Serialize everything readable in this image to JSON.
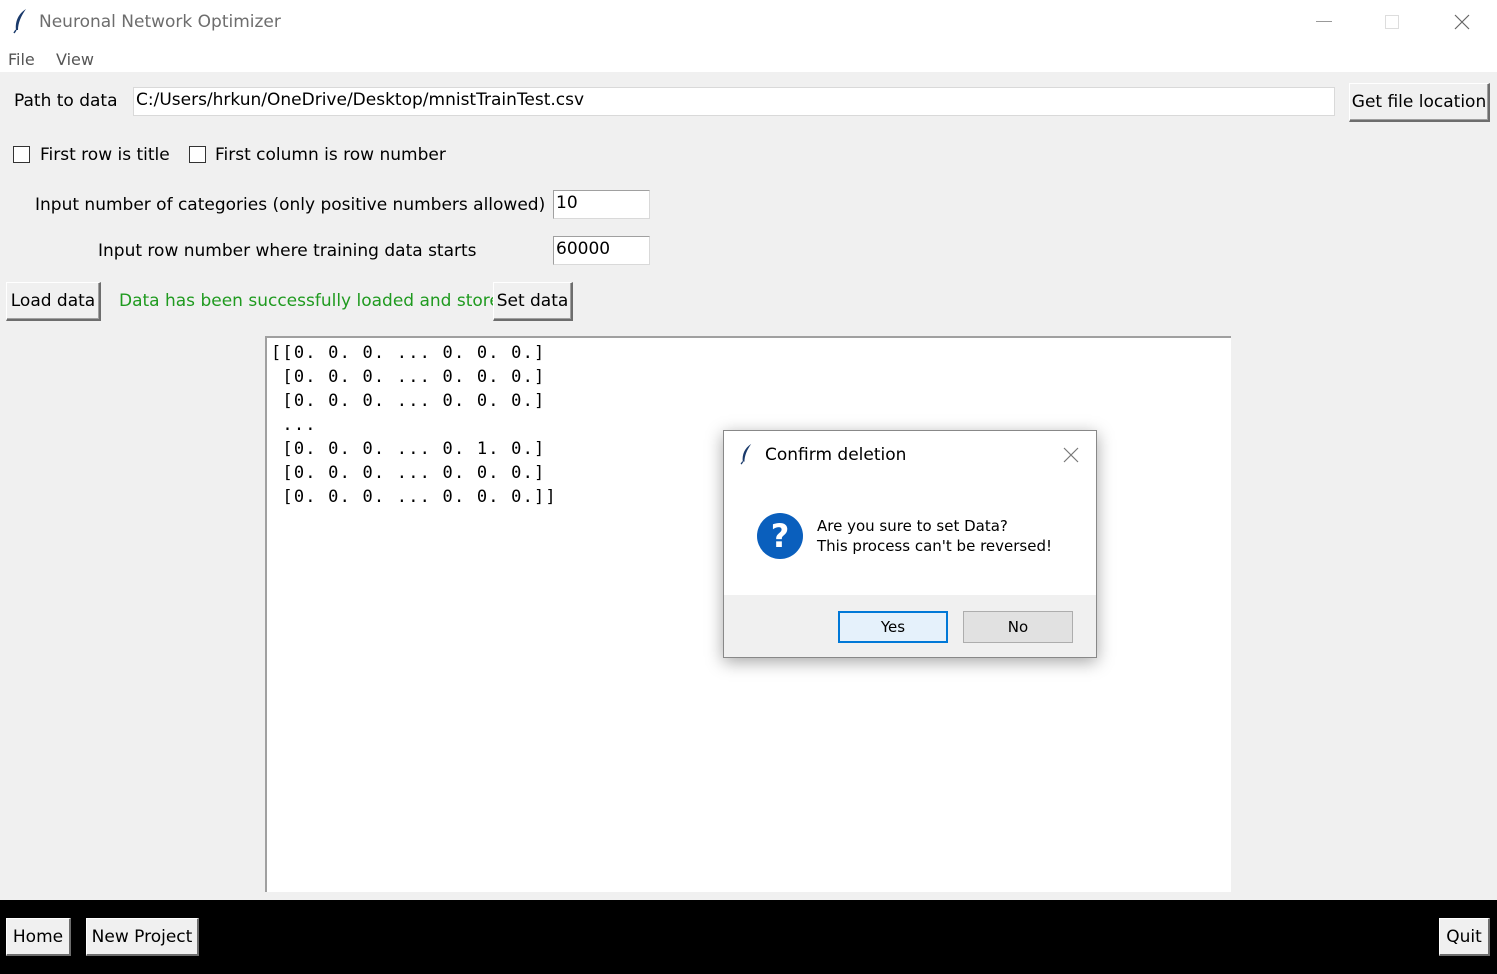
{
  "window": {
    "title": "Neuronal Network Optimizer"
  },
  "menu": {
    "items": [
      "File",
      "View"
    ]
  },
  "path": {
    "label": "Path to data",
    "value": "C:/Users/hrkun/OneDrive/Desktop/mnistTrainTest.csv",
    "button": "Get file location"
  },
  "options": {
    "first_row_title": {
      "label": "First row is title",
      "checked": false
    },
    "first_col_rownum": {
      "label": "First column is row number",
      "checked": false
    }
  },
  "categories": {
    "label": "Input number of categories (only positive numbers allowed)",
    "value": "10"
  },
  "training_start": {
    "label": "Input row number where training data starts",
    "value": "60000"
  },
  "actions": {
    "load_label": "Load data",
    "status": "Data has been successfully loaded and stored.",
    "status_color": "#1f9a1f",
    "set_label": "Set data"
  },
  "output": {
    "lines": [
      "[[0. 0. 0. ... 0. 0. 0.]",
      " [0. 0. 0. ... 0. 0. 0.]",
      " [0. 0. 0. ... 0. 0. 0.]",
      " ...",
      " [0. 0. 0. ... 0. 1. 0.]",
      " [0. 0. 0. ... 0. 0. 0.]",
      " [0. 0. 0. ... 0. 0. 0.]]"
    ]
  },
  "bottom": {
    "home": "Home",
    "new_project": "New Project",
    "quit": "Quit"
  },
  "dialog": {
    "title": "Confirm deletion",
    "icon": "question-icon",
    "message_line1": "Are you sure to set Data?",
    "message_line2": "This process can't be reversed!",
    "yes": "Yes",
    "no": "No"
  }
}
